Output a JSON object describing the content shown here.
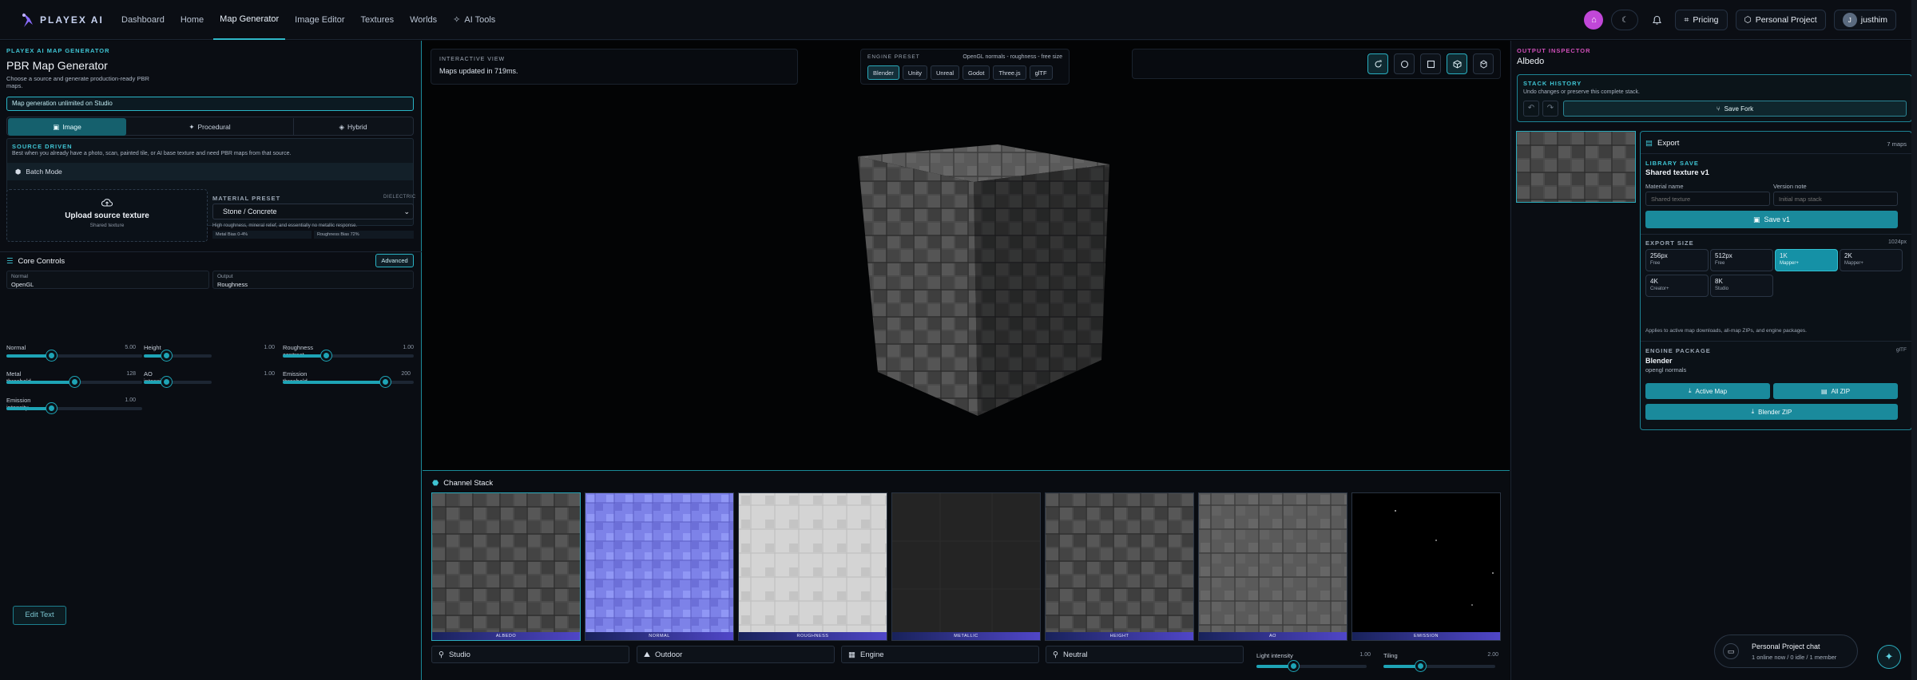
{
  "brand": {
    "name": "PLAYEX AI"
  },
  "nav": [
    "Dashboard",
    "Home",
    "Map Generator",
    "Image Editor",
    "Textures",
    "Worlds",
    "AI Tools"
  ],
  "topbar": {
    "pricing": "Pricing",
    "project": "Personal Project",
    "user": "justhim"
  },
  "left": {
    "kicker": "PLAYEX AI MAP GENERATOR",
    "title": "PBR Map Generator",
    "subtitle": "Choose a source and generate production-ready PBR maps.",
    "plan_banner": "Map generation unlimited on Studio",
    "tabs": [
      "Image",
      "Procedural",
      "Hybrid"
    ],
    "source_kicker": "SOURCE DRIVEN",
    "source_desc": "Best when you already have a photo, scan, painted tile, or AI base texture and need PBR maps from that source.",
    "batch": "Batch Mode",
    "upload_title": "Upload source texture",
    "upload_sub": "Shared texture",
    "preset_label": "MATERIAL PRESET",
    "preset_tag": "DIELECTRIC",
    "preset_value": "Stone / Concrete",
    "preset_desc": "High roughness, mineral relief, and essentially no metallic response.",
    "metal_bias": "Metal Bias 0-4%",
    "rough_bias": "Roughness Bias 72%",
    "core_title": "Core Controls",
    "advanced": "Advanced",
    "normal_label": "Normal",
    "normal_value": "OpenGL",
    "output_label": "Output",
    "output_value": "Roughness",
    "controls": [
      {
        "name": "Normal",
        "value": "5.00",
        "level": 0.33
      },
      {
        "name": "Height",
        "value": "1.00",
        "level": 0.33
      },
      {
        "name": "Roughness contrast",
        "value": "1.00",
        "level": 0.33
      },
      {
        "name": "Metal threshold",
        "value": "128",
        "level": 0.5
      },
      {
        "name": "AO intensity",
        "value": "1.00",
        "level": 0.33
      },
      {
        "name": "Emission threshold",
        "value": "200",
        "level": 0.78
      },
      {
        "name": "Emission intensity",
        "value": "1.00",
        "level": 0.33
      }
    ],
    "edit_text": "Edit Text"
  },
  "viewport": {
    "kicker": "INTERACTIVE VIEW",
    "status": "Maps updated in 719ms.",
    "engine_kicker": "ENGINE PRESET",
    "engine_note": "OpenGL normals - roughness - free size",
    "engines": [
      "Blender",
      "Unity",
      "Unreal",
      "Godot",
      "Three.js",
      "glTF"
    ],
    "selected_engine": "Blender"
  },
  "channels": {
    "title": "Channel Stack",
    "maps": [
      "ALBEDO",
      "NORMAL",
      "ROUGHNESS",
      "METALLIC",
      "HEIGHT",
      "AO",
      "EMISSION"
    ],
    "env": [
      "Studio",
      "Outdoor",
      "Engine",
      "Neutral"
    ],
    "light_label": "Light intensity",
    "light_value": "1.00",
    "tiling_label": "Tiling",
    "tiling_value": "2.00"
  },
  "inspector": {
    "kicker": "OUTPUT INSPECTOR",
    "title": "Albedo",
    "history_kicker": "STACK HISTORY",
    "history_desc": "Undo changes or preserve this complete stack.",
    "save_fork": "Save Fork",
    "export_title": "Export",
    "export_count": "7 maps",
    "library_kicker": "LIBRARY SAVE",
    "library_name": "Shared texture v1",
    "material_label": "Material name",
    "material_placeholder": "Shared texture",
    "version_label": "Version note",
    "version_placeholder": "Initial map stack",
    "save_btn": "Save v1",
    "size_kicker": "EXPORT SIZE",
    "size_value": "1024px",
    "sizes": [
      {
        "size": "256px",
        "tier": "Free"
      },
      {
        "size": "512px",
        "tier": "Free"
      },
      {
        "size": "1K",
        "tier": "Mapper+"
      },
      {
        "size": "2K",
        "tier": "Mapper+"
      },
      {
        "size": "4K",
        "tier": "Creator+"
      },
      {
        "size": "8K",
        "tier": "Studio"
      }
    ],
    "size_note": "Applies to active map downloads, all-map ZIPs, and engine packages.",
    "package_kicker": "ENGINE PACKAGE",
    "package_tag": "glTF",
    "package_name": "Blender",
    "package_sub": "opengl normals",
    "active_map": "Active Map",
    "all_zip": "All ZIP",
    "blender_zip": "Blender ZIP"
  },
  "chat": {
    "title": "Personal Project chat",
    "status": "1 online now / 0 idle / 1 member"
  }
}
